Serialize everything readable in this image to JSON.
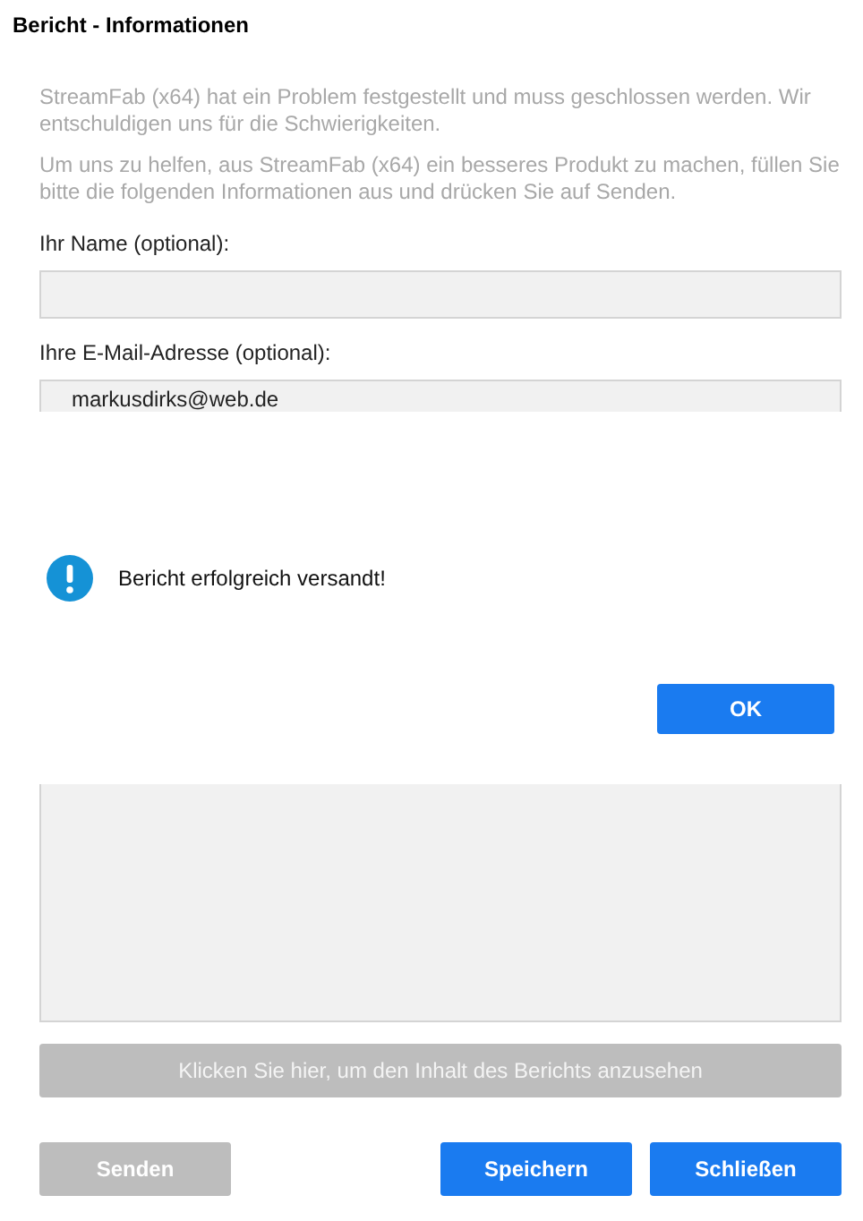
{
  "window": {
    "title": "Bericht - Informationen"
  },
  "paragraphs": [
    "StreamFab (x64) hat ein Problem festgestellt und muss geschlossen werden. Wir entschuldigen uns für die Schwierigkeiten.",
    "Um uns zu helfen, aus StreamFab (x64) ein besseres Produkt zu machen, füllen Sie bitte die folgenden Informationen aus und drücken Sie auf Senden."
  ],
  "fields": [
    {
      "label": "Ihr Name (optional):"
    },
    {
      "label": "Ihre E-Mail-Adresse (optional):",
      "value": "markusdirks@web.de"
    }
  ],
  "message_box": {
    "text": "Bericht erfolgreich versandt!",
    "button": "OK"
  },
  "details_button": {
    "label": "Klicken Sie hier, um den Inhalt des Berichts anzusehen",
    "disabled": true
  },
  "buttons": [
    {
      "label": "Senden",
      "disabled": true
    },
    {
      "label": "Speichern",
      "disabled": false
    },
    {
      "label": "Schließen",
      "disabled": false
    }
  ]
}
